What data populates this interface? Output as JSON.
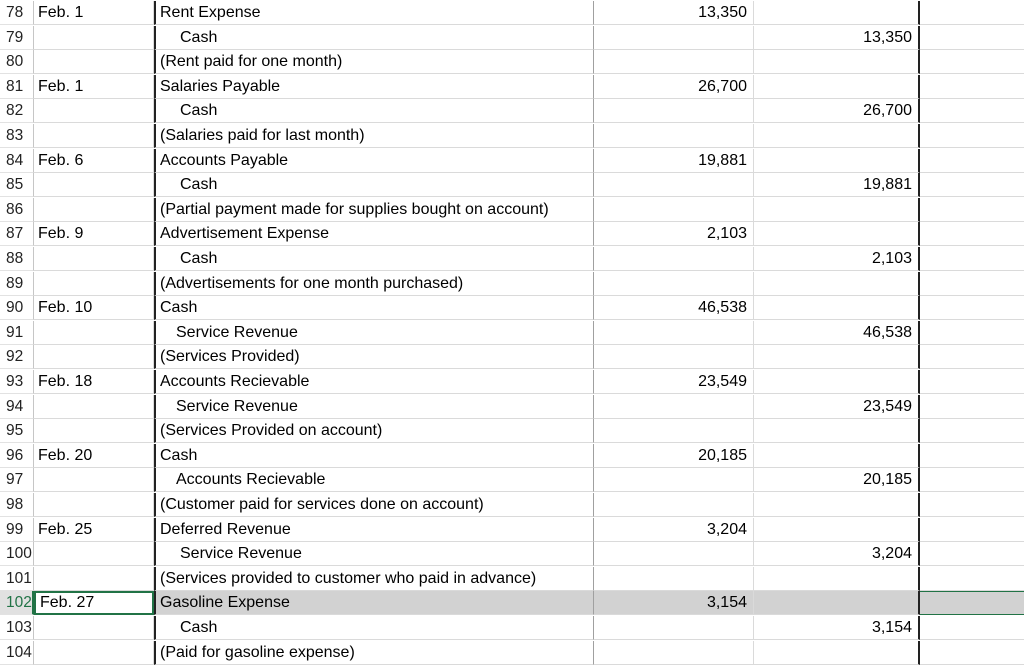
{
  "rows": [
    {
      "num": "78",
      "date": "Feb. 1",
      "desc": "Rent Expense",
      "indent": 0,
      "debit": "13,350",
      "credit": ""
    },
    {
      "num": "79",
      "date": "",
      "desc": "Cash",
      "indent": 1,
      "debit": "",
      "credit": "13,350"
    },
    {
      "num": "80",
      "date": "",
      "desc": "(Rent paid for one month)",
      "indent": 0,
      "debit": "",
      "credit": ""
    },
    {
      "num": "81",
      "date": "Feb. 1",
      "desc": "Salaries Payable",
      "indent": 0,
      "debit": "26,700",
      "credit": ""
    },
    {
      "num": "82",
      "date": "",
      "desc": "Cash",
      "indent": 1,
      "debit": "",
      "credit": "26,700"
    },
    {
      "num": "83",
      "date": "",
      "desc": "(Salaries paid for last month)",
      "indent": 0,
      "debit": "",
      "credit": ""
    },
    {
      "num": "84",
      "date": "Feb. 6",
      "desc": "Accounts Payable",
      "indent": 0,
      "debit": "19,881",
      "credit": ""
    },
    {
      "num": "85",
      "date": "",
      "desc": "Cash",
      "indent": 1,
      "debit": "",
      "credit": "19,881"
    },
    {
      "num": "86",
      "date": "",
      "desc": "(Partial payment made for supplies bought on account)",
      "indent": 0,
      "debit": "",
      "credit": ""
    },
    {
      "num": "87",
      "date": "Feb. 9",
      "desc": "Advertisement Expense",
      "indent": 0,
      "debit": "2,103",
      "credit": ""
    },
    {
      "num": "88",
      "date": "",
      "desc": "Cash",
      "indent": 1,
      "debit": "",
      "credit": "2,103"
    },
    {
      "num": "89",
      "date": "",
      "desc": "(Advertisements for one month purchased)",
      "indent": 0,
      "debit": "",
      "credit": ""
    },
    {
      "num": "90",
      "date": "Feb. 10",
      "desc": "Cash",
      "indent": 0,
      "debit": "46,538",
      "credit": ""
    },
    {
      "num": "91",
      "date": "",
      "desc": "Service Revenue",
      "indent": 2,
      "debit": "",
      "credit": "46,538"
    },
    {
      "num": "92",
      "date": "",
      "desc": "(Services Provided)",
      "indent": 0,
      "debit": "",
      "credit": ""
    },
    {
      "num": "93",
      "date": "Feb. 18",
      "desc": "Accounts Recievable",
      "indent": 0,
      "debit": "23,549",
      "credit": ""
    },
    {
      "num": "94",
      "date": "",
      "desc": "Service Revenue",
      "indent": 2,
      "debit": "",
      "credit": "23,549"
    },
    {
      "num": "95",
      "date": "",
      "desc": "(Services Provided on account)",
      "indent": 0,
      "debit": "",
      "credit": ""
    },
    {
      "num": "96",
      "date": "Feb. 20",
      "desc": "Cash",
      "indent": 0,
      "debit": "20,185",
      "credit": ""
    },
    {
      "num": "97",
      "date": "",
      "desc": "Accounts Recievable",
      "indent": 2,
      "debit": "",
      "credit": "20,185"
    },
    {
      "num": "98",
      "date": "",
      "desc": "(Customer paid for services done on account)",
      "indent": 0,
      "debit": "",
      "credit": ""
    },
    {
      "num": "99",
      "date": "Feb. 25",
      "desc": "Deferred Revenue",
      "indent": 0,
      "debit": "3,204",
      "credit": ""
    },
    {
      "num": "100",
      "date": "",
      "desc": "Service Revenue",
      "indent": 1,
      "debit": "",
      "credit": "3,204"
    },
    {
      "num": "101",
      "date": "",
      "desc": "(Services provided to customer who paid in advance)",
      "indent": 0,
      "debit": "",
      "credit": ""
    },
    {
      "num": "102",
      "date": "Feb. 27",
      "desc": "Gasoline Expense",
      "indent": 0,
      "debit": "3,154",
      "credit": "",
      "selected": true
    },
    {
      "num": "103",
      "date": "",
      "desc": "Cash",
      "indent": 1,
      "debit": "",
      "credit": "3,154"
    },
    {
      "num": "104",
      "date": "",
      "desc": "(Paid for gasoline expense)",
      "indent": 0,
      "debit": "",
      "credit": ""
    }
  ],
  "colors": {
    "selection": "#217346",
    "selected_row_fill": "#d2d2d2"
  }
}
